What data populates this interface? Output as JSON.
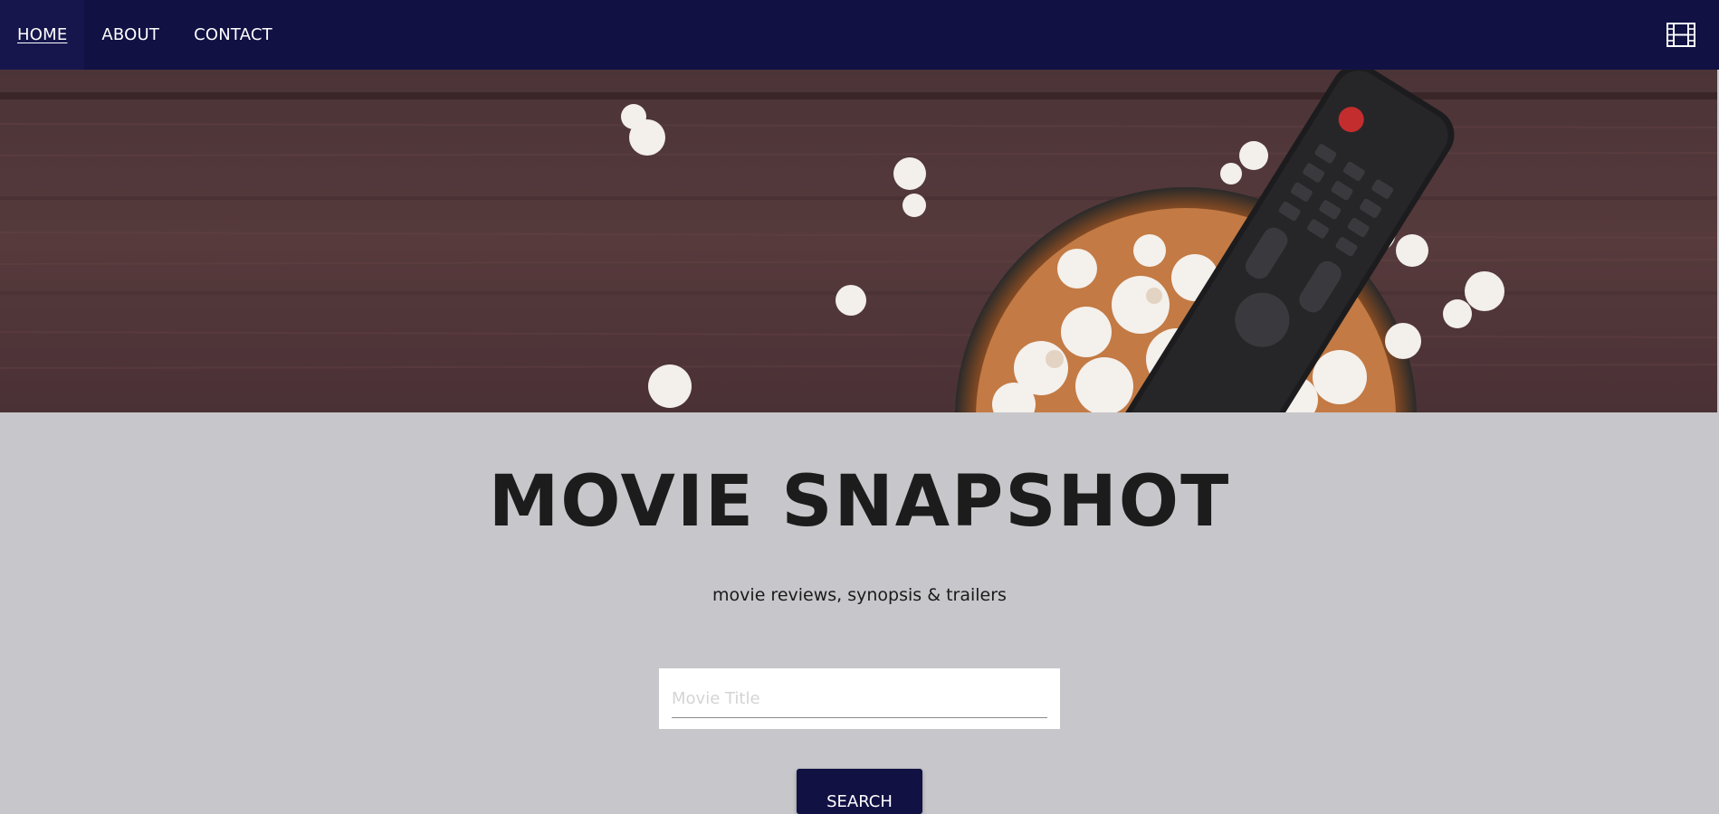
{
  "nav": {
    "items": [
      {
        "label": "HOME",
        "active": true
      },
      {
        "label": "ABOUT",
        "active": false
      },
      {
        "label": "CONTACT",
        "active": false
      }
    ],
    "icon": "film-icon",
    "background": "#111144"
  },
  "hero": {
    "image": "popcorn bowl and TV remote on wooden table"
  },
  "main": {
    "title": "MOVIE SNAPSHOT",
    "tagline": "movie reviews, synopsis & trailers",
    "search": {
      "placeholder": "Movie Title",
      "value": ""
    },
    "search_button_label": "SEARCH",
    "background": "#c7c6ca"
  }
}
